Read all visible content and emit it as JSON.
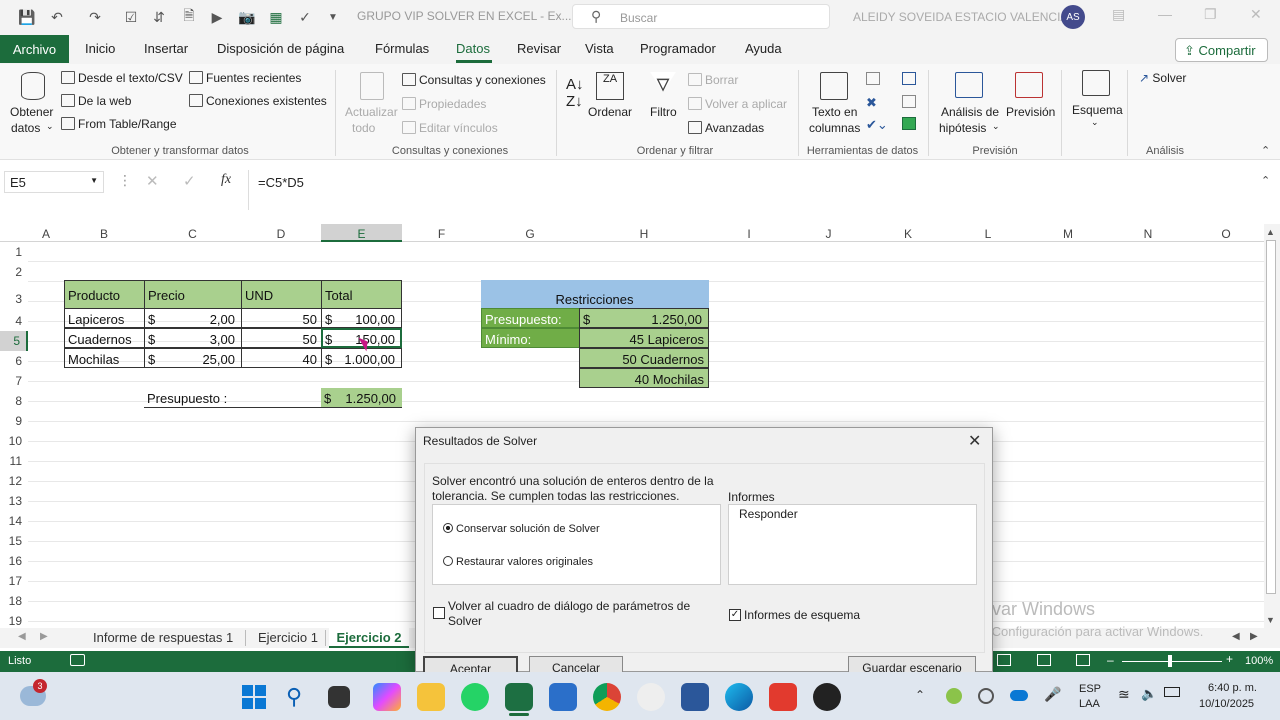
{
  "window": {
    "title": "GRUPO VIP SOLVER EN EXCEL  -  Ex...",
    "search_placeholder": "Buscar",
    "user_name": "ALEIDY SOVEIDA ESTACIO VALENCIA",
    "user_initials": "AS"
  },
  "menu": {
    "archivo": "Archivo",
    "items": [
      "Inicio",
      "Insertar",
      "Disposición de página",
      "Fórmulas",
      "Datos",
      "Revisar",
      "Vista",
      "Programador",
      "Ayuda"
    ],
    "share": "Compartir"
  },
  "ribbon": {
    "obtener_datos": "Obtener",
    "obtener_datos2": "datos",
    "desde_texto": "Desde el texto/CSV",
    "de_la_web": "De la web",
    "from_table": "From Table/Range",
    "fuentes_recientes": "Fuentes recientes",
    "conexiones_existentes": "Conexiones existentes",
    "group1": "Obtener y transformar datos",
    "actualizar": "Actualizar",
    "actualizar2": "todo",
    "consultas": "Consultas y conexiones",
    "propiedades": "Propiedades",
    "editar_vinculos": "Editar vínculos",
    "group2": "Consultas y conexiones",
    "ordenar": "Ordenar",
    "filtro": "Filtro",
    "borrar": "Borrar",
    "volver_aplicar": "Volver a aplicar",
    "avanzadas": "Avanzadas",
    "group3": "Ordenar y filtrar",
    "texto_columnas": "Texto en",
    "texto_columnas2": "columnas",
    "group4": "Herramientas de datos",
    "analisis": "Análisis de",
    "analisis2": "hipótesis",
    "prevision": "Previsión",
    "group5": "Previsión",
    "esquema": "Esquema",
    "solver": "Solver",
    "group6": "Análisis"
  },
  "formula_bar": {
    "name_box": "E5",
    "formula": "=C5*D5"
  },
  "columns": [
    "A",
    "B",
    "C",
    "D",
    "E",
    "F",
    "G",
    "H",
    "I",
    "J",
    "K",
    "L",
    "M",
    "N",
    "O"
  ],
  "rows": [
    "1",
    "2",
    "3",
    "4",
    "5",
    "6",
    "7",
    "8",
    "9",
    "10",
    "11",
    "12",
    "13",
    "14",
    "15",
    "16",
    "17",
    "18",
    "19"
  ],
  "table": {
    "headers": [
      "Producto",
      "Precio",
      "UND",
      "Total"
    ],
    "rows": [
      {
        "producto": "Lapiceros",
        "precio": "2,00",
        "und": "50",
        "total": "100,00"
      },
      {
        "producto": "Cuadernos",
        "precio": "3,00",
        "und": "50",
        "total": "150,00"
      },
      {
        "producto": "Mochilas",
        "precio": "25,00",
        "und": "40",
        "total": "1.000,00"
      }
    ],
    "currency": "$",
    "presupuesto_label": "Presupuesto :",
    "presupuesto_value": "1.250,00"
  },
  "restricciones": {
    "title": "Restricciones",
    "presupuesto_label": "Presupuesto:",
    "presupuesto_value": "1.250,00",
    "minimo_label": "Mínimo:",
    "min1": "45 Lapiceros",
    "min2": "50 Cuadernos",
    "min3": "40 Mochilas"
  },
  "dialog": {
    "title": "Resultados de Solver",
    "message": "Solver encontró una solución de enteros dentro de la tolerancia. Se cumplen todas las restricciones.",
    "option_keep": "Conservar solución de Solver",
    "option_restore": "Restaurar valores originales",
    "informes_label": "Informes",
    "informes_item": "Responder",
    "return_label": "Volver al cuadro de diálogo de parámetros de Solver",
    "outline_label": "Informes de esquema",
    "accept": "Aceptar",
    "cancel": "Cancelar",
    "save_scenario": "Guardar escenario"
  },
  "sheets": [
    "Informe de respuestas 1",
    "Ejercicio 1",
    "Ejercicio 2"
  ],
  "status": {
    "ready": "Listo",
    "zoom": "100%"
  },
  "watermark": {
    "line1": "Activar Windows",
    "line2": "Ve a Configuración para activar Windows."
  },
  "taskbar": {
    "lang1": "ESP",
    "lang2": "LAA",
    "time": "6:40 p. m.",
    "date": "10/10/2025",
    "weather_badge": "3"
  }
}
